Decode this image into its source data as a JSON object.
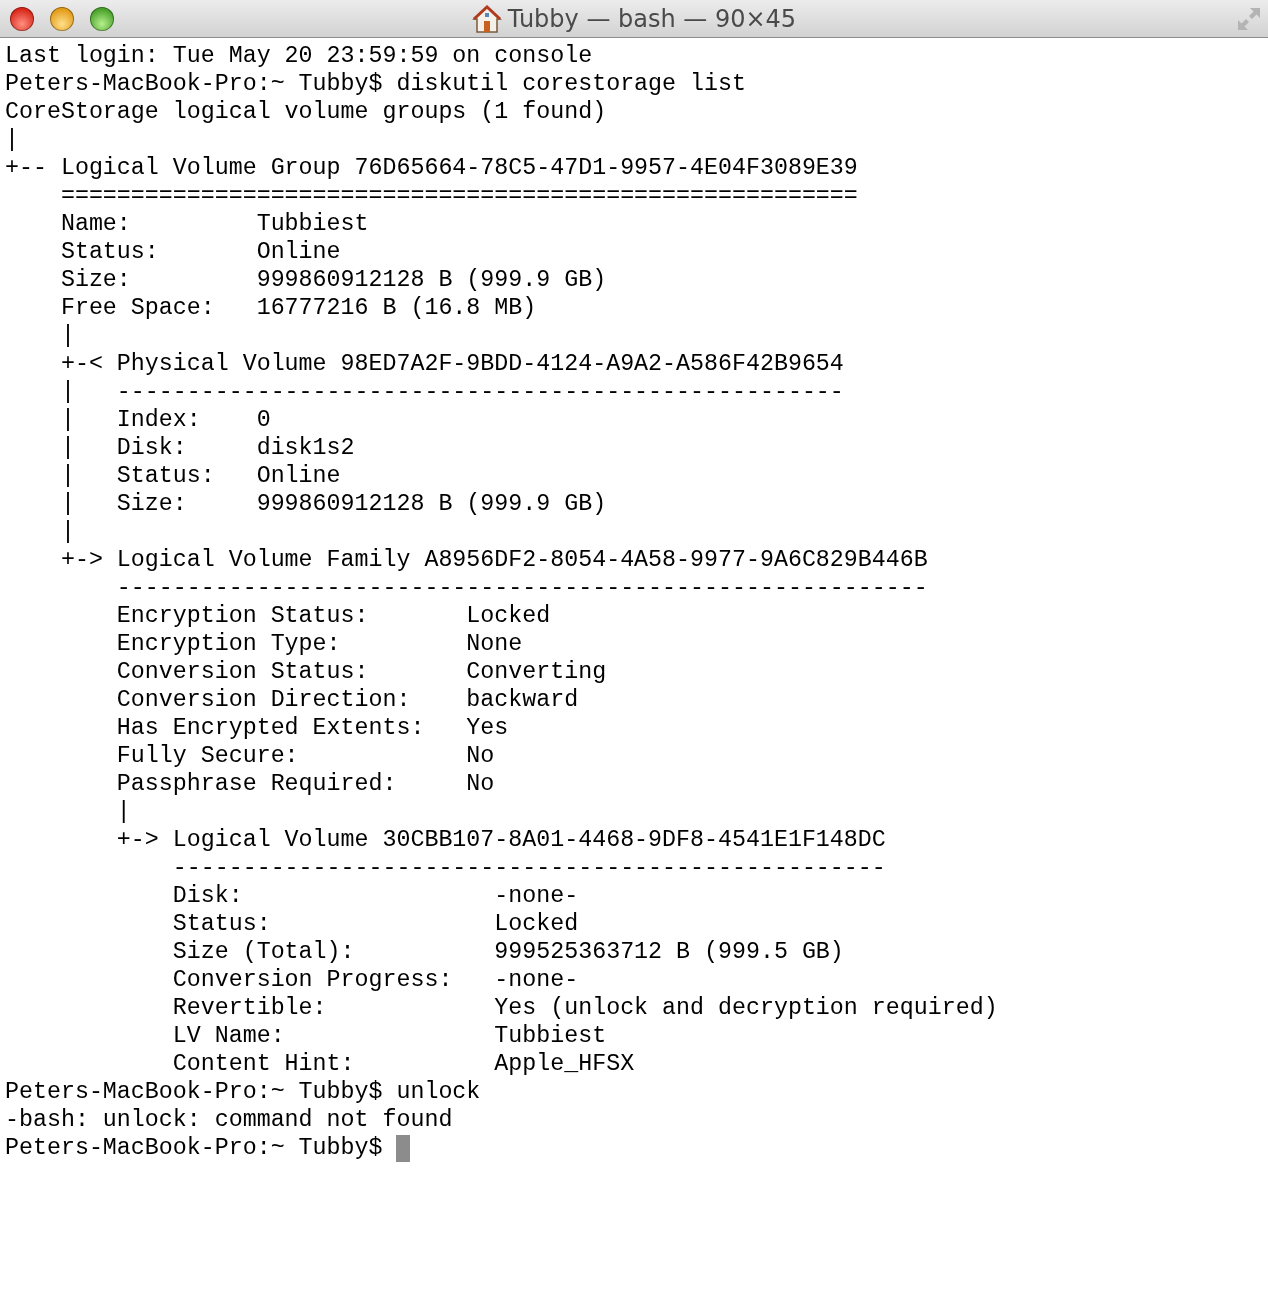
{
  "window": {
    "title": "Tubby — bash — 90×45"
  },
  "terminal": {
    "lines": [
      "Last login: Tue May 20 23:59:59 on console",
      "Peters-MacBook-Pro:~ Tubby$ diskutil corestorage list",
      "CoreStorage logical volume groups (1 found)",
      "|",
      "+-- Logical Volume Group 76D65664-78C5-47D1-9957-4E04F3089E39",
      "    =========================================================",
      "    Name:         Tubbiest",
      "    Status:       Online",
      "    Size:         999860912128 B (999.9 GB)",
      "    Free Space:   16777216 B (16.8 MB)",
      "    |",
      "    +-< Physical Volume 98ED7A2F-9BDD-4124-A9A2-A586F42B9654",
      "    |   ----------------------------------------------------",
      "    |   Index:    0",
      "    |   Disk:     disk1s2",
      "    |   Status:   Online",
      "    |   Size:     999860912128 B (999.9 GB)",
      "    |",
      "    +-> Logical Volume Family A8956DF2-8054-4A58-9977-9A6C829B446B",
      "        ----------------------------------------------------------",
      "        Encryption Status:       Locked",
      "        Encryption Type:         None",
      "        Conversion Status:       Converting",
      "        Conversion Direction:    backward",
      "        Has Encrypted Extents:   Yes",
      "        Fully Secure:            No",
      "        Passphrase Required:     No",
      "        |",
      "        +-> Logical Volume 30CBB107-8A01-4468-9DF8-4541E1F148DC",
      "            ---------------------------------------------------",
      "            Disk:                  -none-",
      "            Status:                Locked",
      "            Size (Total):          999525363712 B (999.5 GB)",
      "            Conversion Progress:   -none-",
      "            Revertible:            Yes (unlock and decryption required)",
      "            LV Name:               Tubbiest",
      "            Content Hint:          Apple_HFSX",
      "Peters-MacBook-Pro:~ Tubby$ unlock",
      "-bash: unlock: command not found"
    ],
    "prompt": "Peters-MacBook-Pro:~ Tubby$ "
  }
}
